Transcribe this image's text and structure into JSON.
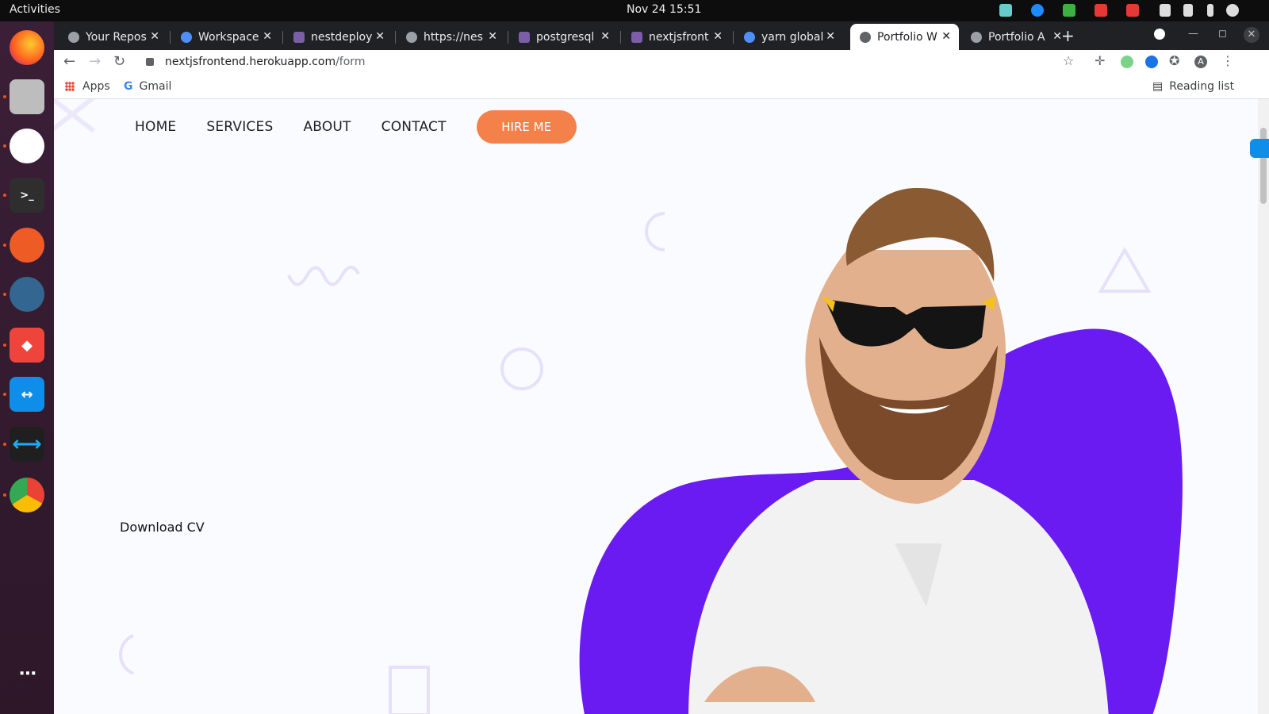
{
  "os": {
    "activities": "Activities",
    "clock": "Nov 24  15:51"
  },
  "dock": {
    "items": [
      "firefox",
      "files",
      "slack",
      "terminal",
      "postman",
      "pgadmin",
      "anydesk",
      "teamviewer",
      "vscode",
      "chrome",
      "show-apps"
    ]
  },
  "browser": {
    "tabs": [
      {
        "title": "Your Repos",
        "color": "#9aa0a6"
      },
      {
        "title": "Workspace",
        "color": "#4f8ff7"
      },
      {
        "title": "nestdeploy",
        "color": "#7b5ea7"
      },
      {
        "title": "https://nes",
        "color": "#9aa0a6"
      },
      {
        "title": "postgresql",
        "color": "#7b5ea7"
      },
      {
        "title": "nextjsfront",
        "color": "#7b5ea7"
      },
      {
        "title": "yarn global",
        "color": "#4f8ff7"
      },
      {
        "title": "Portfolio W",
        "color": "#5f6368",
        "active": true
      },
      {
        "title": "Portfolio A",
        "color": "#9aa0a6"
      }
    ],
    "url_host": "nextjsfrontend.herokuapp.com",
    "url_path": "/form",
    "bookmarks": {
      "apps": "Apps",
      "gmail": "Gmail",
      "reading_list": "Reading list"
    },
    "profile_initial": "A"
  },
  "page": {
    "nav": [
      "HOME",
      "SERVICES",
      "ABOUT",
      "CONTACT"
    ],
    "hire_label": "HIRE ME",
    "download_label": "Download CV",
    "accent_color": "#f4804a",
    "blob_color": "#6a1bf2"
  }
}
